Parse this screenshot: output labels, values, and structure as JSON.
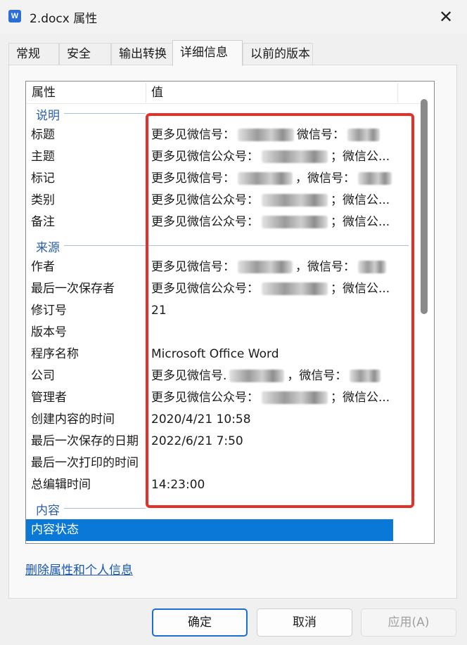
{
  "window": {
    "title": "2.docx 属性",
    "app_icon": "W"
  },
  "tabs": [
    {
      "label": "常规"
    },
    {
      "label": "安全"
    },
    {
      "label": "输出转换"
    },
    {
      "label": "详细信息"
    },
    {
      "label": "以前的版本"
    }
  ],
  "columns": {
    "property": "属性",
    "value": "值"
  },
  "groups": {
    "description": "说明",
    "origin": "来源",
    "content": "内容"
  },
  "rows": [
    {
      "key": "标题",
      "v1": "更多见微信号：",
      "v2": "微信号：",
      "v3": ""
    },
    {
      "key": "主题",
      "v1": "更多见微信公众号：",
      "v2": "；微信公...",
      "v3": ""
    },
    {
      "key": "标记",
      "v1": "更多见微信号：",
      "v2": "，微信号：",
      "v3": ""
    },
    {
      "key": "类别",
      "v1": "更多见微信公众号：",
      "v2": "；微信公...",
      "v3": ""
    },
    {
      "key": "备注",
      "v1": "更多见微信公众号：",
      "v2": "；微信公...",
      "v3": ""
    },
    {
      "key": "作者",
      "v1": "更多见微信号：",
      "v2": "，微信号：",
      "v3": ""
    },
    {
      "key": "最后一次保存者",
      "v1": "更多见微信公众号：",
      "v2": "；微信公...",
      "v3": ""
    },
    {
      "key": "修订号",
      "v1": "21",
      "v2": "",
      "v3": ""
    },
    {
      "key": "版本号",
      "v1": "",
      "v2": "",
      "v3": ""
    },
    {
      "key": "程序名称",
      "v1": "Microsoft Office Word",
      "v2": "",
      "v3": ""
    },
    {
      "key": "公司",
      "v1": "更多见微信号.",
      "v2": "，微信号：",
      "v3": ""
    },
    {
      "key": "管理者",
      "v1": "更多见微信公众号：",
      "v2": "；微信公...",
      "v3": ""
    },
    {
      "key": "创建内容的时间",
      "v1": "2020/4/21 10:58",
      "v2": "",
      "v3": ""
    },
    {
      "key": "最后一次保存的日期",
      "v1": "2022/6/21 7:50",
      "v2": "",
      "v3": ""
    },
    {
      "key": "最后一次打印的时间",
      "v1": "",
      "v2": "",
      "v3": ""
    },
    {
      "key": "总编辑时间",
      "v1": "14:23:00",
      "v2": "",
      "v3": ""
    }
  ],
  "selected_row": {
    "key": "内容状态"
  },
  "link": {
    "label": "删除属性和个人信息"
  },
  "buttons": {
    "ok": "确定",
    "cancel": "取消",
    "apply": "应用(A)"
  },
  "colors": {
    "accent": "#0a78d7",
    "highlight_border": "#e5302a",
    "link": "#1656b8",
    "group_text": "#2a5db0"
  }
}
